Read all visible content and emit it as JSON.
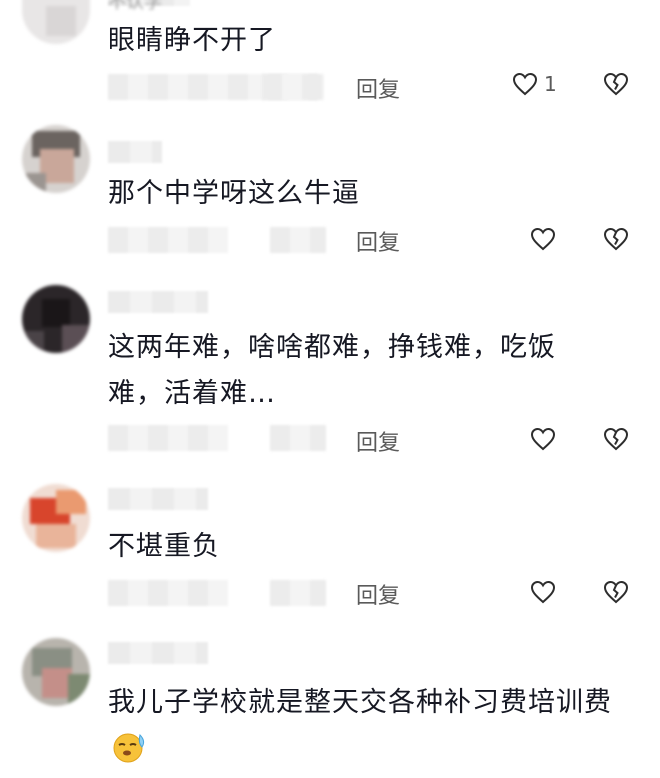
{
  "colors": {
    "text": "#161823",
    "meta": "#5a5a5a",
    "icon_stroke": "#2d2d2d"
  },
  "top_username_partial": "不认学",
  "comments": [
    {
      "text": "眼睛睁不开了",
      "reply_label": "回复",
      "like_count": "1",
      "liked_icon": "heart-outline-icon",
      "dislike_icon": "broken-heart-icon"
    },
    {
      "text": "那个中学呀这么牛逼",
      "reply_label": "回复",
      "like_count": "",
      "liked_icon": "heart-outline-icon",
      "dislike_icon": "broken-heart-icon"
    },
    {
      "text": "这两年难，啥啥都难，挣钱难，吃饭难，活着难…",
      "reply_label": "回复",
      "like_count": "",
      "liked_icon": "heart-outline-icon",
      "dislike_icon": "broken-heart-icon"
    },
    {
      "text": "不堪重负",
      "reply_label": "回复",
      "like_count": "",
      "liked_icon": "heart-outline-icon",
      "dislike_icon": "broken-heart-icon"
    },
    {
      "text": "我儿子学校就是整天交各种补习费培训费",
      "reply_label": "",
      "like_count": "",
      "emoji": "sleepy-face-emoji"
    }
  ]
}
